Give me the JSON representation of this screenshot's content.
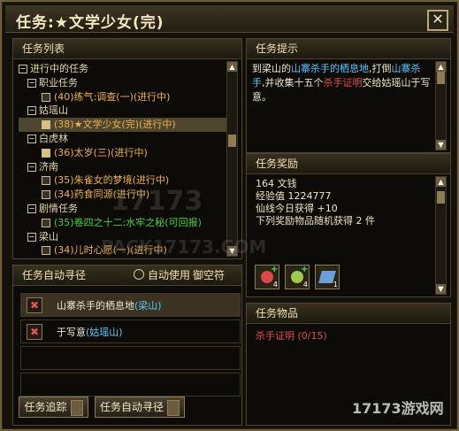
{
  "window": {
    "title": "任务:★文学少女(完)",
    "close_label": "✕"
  },
  "panels": {
    "quest_list": "任务列表",
    "auto_route": "任务自动寻径",
    "quest_tip": "任务提示",
    "quest_reward": "任务奖励",
    "quest_items": "任务物品"
  },
  "tree": {
    "in_progress": "进行中的任务",
    "groups": [
      {
        "name": "职业任务",
        "items": [
          {
            "text": "(40)练气:调查(一)(进行中)",
            "color": "orange"
          }
        ]
      },
      {
        "name": "姑瑶山",
        "items": [
          {
            "text": "(38)★文学少女(完)(进行中)",
            "color": "orange",
            "selected": true
          }
        ]
      },
      {
        "name": "白虎林",
        "items": [
          {
            "text": "(36)太岁(三)(进行中)",
            "color": "orange"
          }
        ]
      },
      {
        "name": "济南",
        "items": [
          {
            "text": "(35)朱雀女的梦境(进行中)",
            "color": "orange"
          },
          {
            "text": "(34)药食同源(进行中)",
            "color": "orange"
          }
        ]
      },
      {
        "name": "剧情任务",
        "items": [
          {
            "text": "(35)卷四之十二:水牢之秘(可回报)",
            "color": "green"
          }
        ]
      },
      {
        "name": "梁山",
        "items": [
          {
            "text": "(34)儿时心愿(一)(进行中)",
            "color": "orange"
          }
        ]
      }
    ]
  },
  "auto_route": {
    "checkbox_label": "自动使用",
    "fly_label": "御空符",
    "rows": [
      {
        "text": "山寨杀手的栖息地",
        "location": "(梁山)"
      },
      {
        "text": "于写意",
        "location": "(姑瑶山)"
      }
    ],
    "buttons": {
      "track": "任务追踪",
      "route": "任务自动寻径"
    }
  },
  "tip": {
    "line1_prefix": "到梁山的",
    "line1_highlight": "山寨杀手的栖息地",
    "line1_suffix": ",打倒",
    "line1_target": "山寨杀手",
    "line2_prefix": ",并收集十五个",
    "line2_item": "杀手证明",
    "line2_suffix": "交给姑瑶山于写意。"
  },
  "reward": {
    "coin": "164 文钱",
    "exp": "经验值 1224777",
    "daily": "仙线今日获得 +10",
    "random": "下列奖励物品随机获得 2 件",
    "item_counts": [
      "4",
      "4",
      "1"
    ]
  },
  "quest_items": {
    "item": "杀手证明 (0/15)"
  },
  "watermark": {
    "top": "17173",
    "mid": "PACK17173.COM",
    "logo": "17173游戏网"
  }
}
